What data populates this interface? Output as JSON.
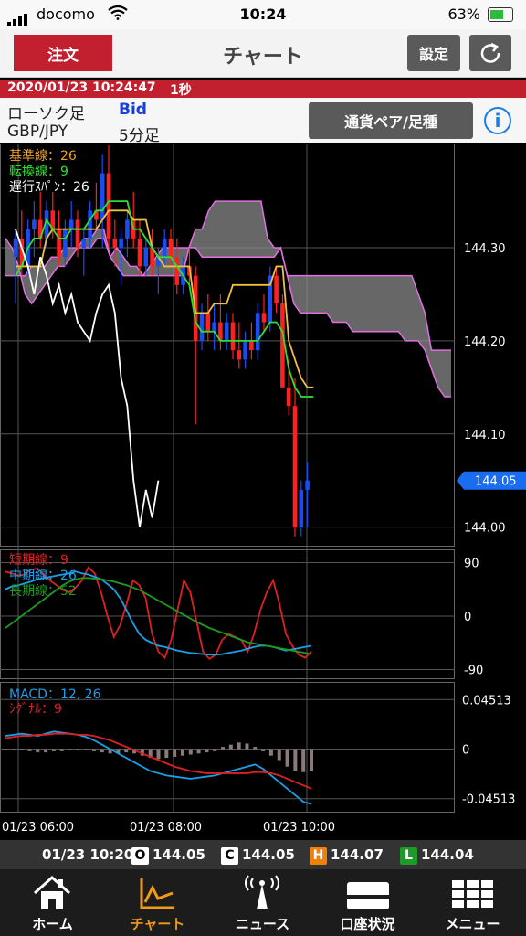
{
  "status_bar": {
    "carrier": "docomo",
    "time": "10:24",
    "battery": "63%"
  },
  "header": {
    "order_button": "注文",
    "title": "チャート",
    "settings_button": "設定"
  },
  "ticker_bar": {
    "timestamp": "2020/01/23 10:24:47",
    "interval": "1秒"
  },
  "info_bar": {
    "chart_type": "ローソク足",
    "price_side": "Bid",
    "pair": "GBP/JPY",
    "timeframe": "5分足",
    "pair_button": "通貨ペア/足種",
    "info_icon": "i"
  },
  "indicators": {
    "ichimoku": {
      "base_line": "基準線：26",
      "conversion_line": "転換線：9",
      "lagging_span": "遅行ｽﾊﾟﾝ：26"
    },
    "ma": {
      "short": "短期線：9",
      "mid": "中期線：26",
      "long": "長期線：52"
    },
    "macd": {
      "macd": "MACD：12, 26",
      "signal": "ｼｸﾞﾅﾙ：9"
    }
  },
  "colors": {
    "accent_red": "#c2202f",
    "active_tab": "#f19a18",
    "price_marker": "#1a6cf0"
  },
  "chart_data": [
    {
      "type": "candlestick",
      "price_axis_labels": [
        "144.30",
        "144.20",
        "144.10",
        "144.00"
      ],
      "current_price": "144.05",
      "time_axis_labels": [
        "01/23 06:00",
        "01/23 08:00",
        "01/23 10:00"
      ],
      "ylim": [
        143.98,
        144.41
      ],
      "candles": [
        [
          144.29,
          144.32,
          144.24,
          144.31
        ],
        [
          144.31,
          144.34,
          144.27,
          144.28
        ],
        [
          144.28,
          144.33,
          144.27,
          144.32
        ],
        [
          144.32,
          144.35,
          144.29,
          144.33
        ],
        [
          144.33,
          144.36,
          144.3,
          144.31
        ],
        [
          144.31,
          144.35,
          144.3,
          144.34
        ],
        [
          144.34,
          144.36,
          144.31,
          144.32
        ],
        [
          144.32,
          144.34,
          144.28,
          144.29
        ],
        [
          144.29,
          144.33,
          144.28,
          144.32
        ],
        [
          144.32,
          144.35,
          144.3,
          144.33
        ],
        [
          144.33,
          144.34,
          144.29,
          144.3
        ],
        [
          144.3,
          144.32,
          144.27,
          144.31
        ],
        [
          144.31,
          144.35,
          144.3,
          144.34
        ],
        [
          144.34,
          144.37,
          144.32,
          144.33
        ],
        [
          144.33,
          144.4,
          144.3,
          144.38
        ],
        [
          144.38,
          144.41,
          144.3,
          144.31
        ],
        [
          144.31,
          144.33,
          144.28,
          144.3
        ],
        [
          144.3,
          144.32,
          144.26,
          144.31
        ],
        [
          144.31,
          144.34,
          144.29,
          144.33
        ],
        [
          144.33,
          144.36,
          144.3,
          144.31
        ],
        [
          144.31,
          144.33,
          144.27,
          144.28
        ],
        [
          144.28,
          144.31,
          144.27,
          144.3
        ],
        [
          144.3,
          144.32,
          144.27,
          144.28
        ],
        [
          144.28,
          144.3,
          144.25,
          144.29
        ],
        [
          144.29,
          144.32,
          144.28,
          144.31
        ],
        [
          144.31,
          144.32,
          144.28,
          144.29
        ],
        [
          144.29,
          144.31,
          144.25,
          144.26
        ],
        [
          144.26,
          144.29,
          144.25,
          144.28
        ],
        [
          144.28,
          144.3,
          144.26,
          144.27
        ],
        [
          144.27,
          144.28,
          144.11,
          144.2
        ],
        [
          144.2,
          144.24,
          144.19,
          144.23
        ],
        [
          144.23,
          144.25,
          144.2,
          144.21
        ],
        [
          144.21,
          144.24,
          144.19,
          144.22
        ],
        [
          144.22,
          144.25,
          144.19,
          144.2
        ],
        [
          144.2,
          144.23,
          144.19,
          144.22
        ],
        [
          144.22,
          144.23,
          144.18,
          144.19
        ],
        [
          144.19,
          144.22,
          144.17,
          144.18
        ],
        [
          144.18,
          144.21,
          144.17,
          144.2
        ],
        [
          144.2,
          144.22,
          144.18,
          144.19
        ],
        [
          144.19,
          144.24,
          144.18,
          144.23
        ],
        [
          144.23,
          144.25,
          144.21,
          144.22
        ],
        [
          144.22,
          144.28,
          144.21,
          144.27
        ],
        [
          144.27,
          144.28,
          144.23,
          144.24
        ],
        [
          144.24,
          144.25,
          144.16,
          144.15
        ],
        [
          144.15,
          144.18,
          144.12,
          144.13
        ],
        [
          144.13,
          144.16,
          143.99,
          144.0
        ],
        [
          144.0,
          144.05,
          143.99,
          144.04
        ],
        [
          144.04,
          144.07,
          144.0,
          144.05
        ]
      ],
      "ichimoku": {
        "base": [
          144.28,
          144.28,
          144.28,
          144.28,
          144.28,
          144.31,
          144.32,
          144.32,
          144.32,
          144.32,
          144.32,
          144.32,
          144.32,
          144.32,
          144.33,
          144.34,
          144.34,
          144.34,
          144.34,
          144.33,
          144.33,
          144.33,
          144.3,
          144.29,
          144.28,
          144.28,
          144.28,
          144.28,
          144.28,
          144.23,
          144.23,
          144.23,
          144.24,
          144.24,
          144.24,
          144.26,
          144.26,
          144.26,
          144.26,
          144.26,
          144.26,
          144.26,
          144.28,
          144.28,
          144.2,
          144.18,
          144.16,
          144.15,
          144.15
        ],
        "conversion": [
          144.27,
          144.28,
          144.3,
          144.31,
          144.31,
          144.33,
          144.32,
          144.31,
          144.31,
          144.32,
          144.32,
          144.32,
          144.33,
          144.34,
          144.34,
          144.35,
          144.35,
          144.35,
          144.35,
          144.32,
          144.32,
          144.31,
          144.3,
          144.29,
          144.29,
          144.29,
          144.28,
          144.27,
          144.26,
          144.22,
          144.21,
          144.21,
          144.21,
          144.2,
          144.2,
          144.2,
          144.2,
          144.2,
          144.2,
          144.2,
          144.21,
          144.22,
          144.22,
          144.21,
          144.17,
          144.15,
          144.14,
          144.14,
          144.14
        ],
        "lagging": [
          144.32,
          144.3,
          144.28,
          144.25,
          144.29,
          144.27,
          144.24,
          144.26,
          144.23,
          144.25,
          144.22,
          144.21,
          144.2,
          144.23,
          144.25,
          144.26,
          144.23,
          144.16,
          144.13,
          144.05,
          144.0,
          144.04,
          144.01,
          144.05
        ],
        "span_a": [
          144.31,
          144.3,
          144.28,
          144.25,
          144.24,
          144.25,
          144.26,
          144.27,
          144.28,
          144.28,
          144.29,
          144.3,
          144.3,
          144.3,
          144.31,
          144.31,
          144.29,
          144.3,
          144.29,
          144.28,
          144.28,
          144.27,
          144.28,
          144.29,
          144.3,
          144.3,
          144.3,
          144.3,
          144.3,
          144.3,
          144.29,
          144.29,
          144.29,
          144.29,
          144.29,
          144.29,
          144.29,
          144.29,
          144.29,
          144.29,
          144.29,
          144.29,
          144.3,
          144.27,
          144.27,
          144.27,
          144.27,
          144.27,
          144.27,
          144.27,
          144.27,
          144.27,
          144.27,
          144.27,
          144.27,
          144.27,
          144.27,
          144.27,
          144.27,
          144.27,
          144.27,
          144.27,
          144.27,
          144.25,
          144.23,
          144.19,
          144.19,
          144.19,
          144.19
        ],
        "span_b": [
          144.27,
          144.27,
          144.27,
          144.27,
          144.28,
          144.28,
          144.28,
          144.29,
          144.29,
          144.3,
          144.3,
          144.3,
          144.31,
          144.31,
          144.32,
          144.32,
          144.29,
          144.28,
          144.27,
          144.27,
          144.27,
          144.27,
          144.27,
          144.27,
          144.27,
          144.27,
          144.27,
          144.27,
          144.3,
          144.32,
          144.32,
          144.34,
          144.35,
          144.35,
          144.35,
          144.35,
          144.35,
          144.35,
          144.35,
          144.35,
          144.31,
          144.3,
          144.3,
          144.27,
          144.24,
          144.23,
          144.23,
          144.23,
          144.23,
          144.23,
          144.22,
          144.22,
          144.22,
          144.21,
          144.21,
          144.21,
          144.21,
          144.21,
          144.21,
          144.21,
          144.21,
          144.2,
          144.2,
          144.2,
          144.19,
          144.17,
          144.15,
          144.14,
          144.14
        ]
      }
    },
    {
      "type": "line",
      "axis_labels": [
        "90",
        "0",
        "-90"
      ],
      "ylim": [
        -100,
        100
      ],
      "series": [
        {
          "name": "短期線：9",
          "color": "#e02020",
          "values": [
            75,
            72,
            68,
            70,
            78,
            80,
            70,
            60,
            52,
            44,
            40,
            48,
            60,
            82,
            72,
            40,
            0,
            -35,
            -15,
            20,
            60,
            52,
            30,
            -30,
            -60,
            -70,
            -40,
            10,
            60,
            40,
            -10,
            -60,
            -72,
            -65,
            -40,
            -30,
            -35,
            -40,
            -60,
            -30,
            10,
            40,
            60,
            20,
            -30,
            -50,
            -65,
            -70,
            -60
          ]
        },
        {
          "name": "中期線：26",
          "color": "#1aa0e8",
          "values": [
            45,
            50,
            52,
            55,
            58,
            62,
            64,
            66,
            68,
            70,
            72,
            75,
            72,
            70,
            66,
            62,
            54,
            45,
            30,
            10,
            -12,
            -30,
            -40,
            -45,
            -50,
            -52,
            -55,
            -58,
            -60,
            -62,
            -63,
            -64,
            -65,
            -65,
            -64,
            -62,
            -60,
            -58,
            -55,
            -52,
            -50,
            -50,
            -52,
            -55,
            -58,
            -56,
            -54,
            -52,
            -50
          ]
        },
        {
          "name": "長期線：52",
          "color": "#1e9a1e",
          "values": [
            -20,
            -12,
            -4,
            4,
            12,
            20,
            28,
            36,
            44,
            52,
            58,
            62,
            64,
            64,
            63,
            62,
            60,
            58,
            55,
            52,
            48,
            44,
            38,
            32,
            26,
            20,
            14,
            8,
            2,
            -4,
            -10,
            -15,
            -20,
            -24,
            -28,
            -32,
            -36,
            -40,
            -44,
            -46,
            -48,
            -50,
            -52,
            -54,
            -56,
            -58,
            -60,
            -62,
            -64
          ]
        }
      ]
    },
    {
      "type": "bar+line",
      "axis_labels": [
        "0.04513",
        "0",
        "-0.04513"
      ],
      "ylim": [
        -0.052,
        0.052
      ],
      "histogram": [
        0,
        0,
        0,
        -0.002,
        -0.003,
        -0.003,
        -0.002,
        -0.002,
        -0.001,
        0,
        -0.001,
        -0.002,
        -0.003,
        -0.004,
        -0.004,
        -0.003,
        -0.004,
        -0.006,
        -0.008,
        -0.009,
        -0.008,
        -0.007,
        -0.006,
        -0.005,
        -0.004,
        -0.003,
        -0.002,
        0.002,
        0.004,
        0.006,
        0.005,
        0.002,
        -0.002,
        -0.006,
        -0.01,
        -0.016,
        -0.02,
        -0.021,
        -0.02
      ],
      "macd": [
        0.012,
        0.013,
        0.014,
        0.013,
        0.012,
        0.014,
        0.016,
        0.015,
        0.014,
        0.013,
        0.011,
        0.008,
        0.004,
        0,
        -0.004,
        -0.008,
        -0.012,
        -0.016,
        -0.02,
        -0.022,
        -0.024,
        -0.025,
        -0.026,
        -0.027,
        -0.026,
        -0.025,
        -0.024,
        -0.022,
        -0.02,
        -0.018,
        -0.016,
        -0.014,
        -0.018,
        -0.024,
        -0.03,
        -0.036,
        -0.042,
        -0.048,
        -0.05
      ],
      "signal": [
        0.01,
        0.011,
        0.012,
        0.012,
        0.013,
        0.013,
        0.014,
        0.014,
        0.014,
        0.013,
        0.013,
        0.012,
        0.01,
        0.008,
        0.005,
        0.002,
        -0.001,
        -0.004,
        -0.007,
        -0.01,
        -0.013,
        -0.016,
        -0.018,
        -0.02,
        -0.021,
        -0.022,
        -0.022,
        -0.022,
        -0.022,
        -0.022,
        -0.022,
        -0.021,
        -0.021,
        -0.022,
        -0.024,
        -0.027,
        -0.03,
        -0.033,
        -0.036
      ]
    }
  ],
  "ohlc_bar": {
    "time": "01/23 10:20",
    "open_tag": "O",
    "open": "144.05",
    "close_tag": "C",
    "close": "144.05",
    "high_tag": "H",
    "high": "144.07",
    "low_tag": "L",
    "low": "144.04"
  },
  "tabs": [
    {
      "label": "ホーム",
      "icon": "home-icon"
    },
    {
      "label": "チャート",
      "icon": "chart-icon",
      "active": true
    },
    {
      "label": "ニュース",
      "icon": "news-icon"
    },
    {
      "label": "口座状況",
      "icon": "account-icon"
    },
    {
      "label": "メニュー",
      "icon": "menu-icon"
    }
  ]
}
